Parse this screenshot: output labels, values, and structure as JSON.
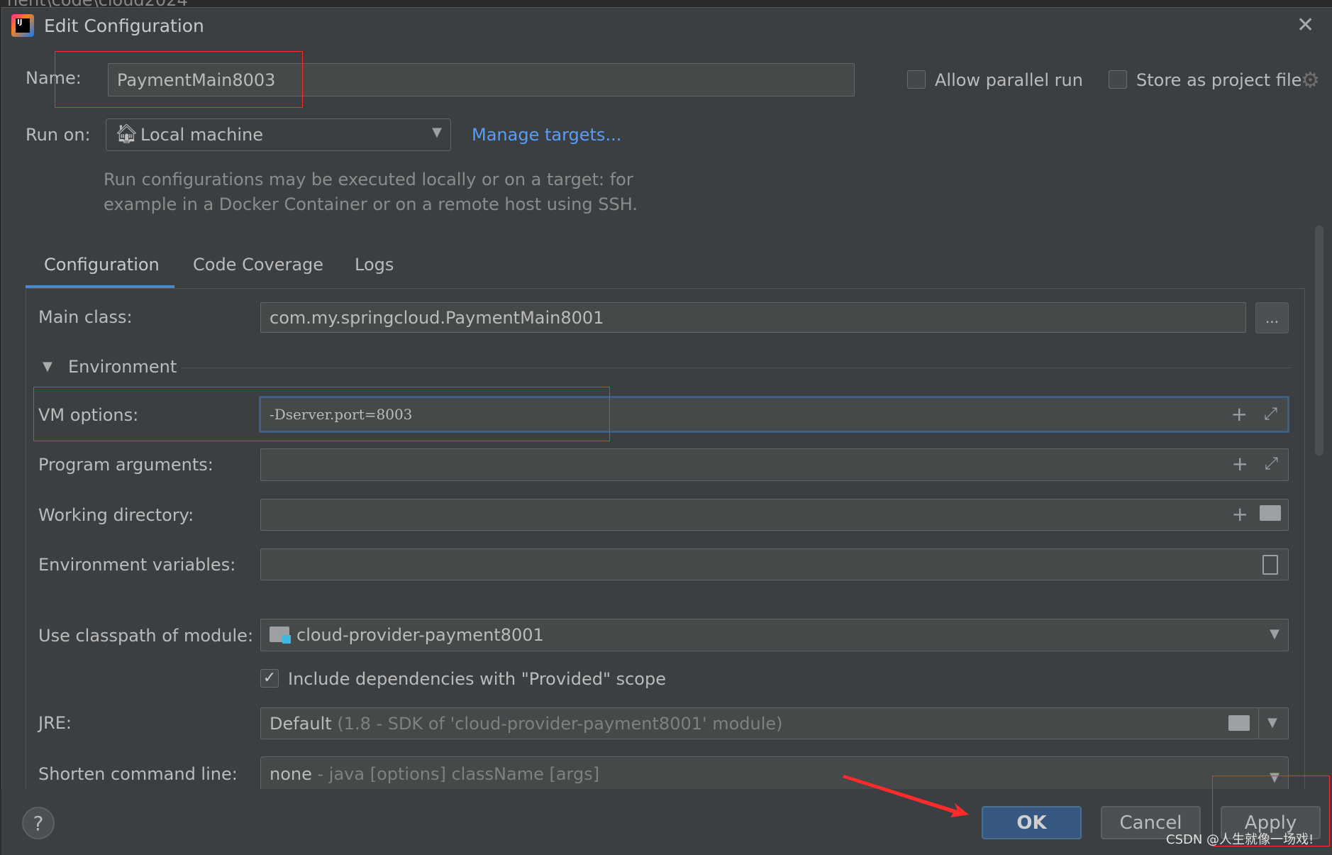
{
  "background_window": {
    "path_fragment": "nent\\code\\cloud2024"
  },
  "dialog": {
    "title": "Edit Configuration",
    "name_label": "Name:",
    "name_value": "PaymentMain8003",
    "allow_parallel_run": {
      "label": "Allow parallel run",
      "checked": false
    },
    "store_as_project_file": {
      "label": "Store as project file",
      "checked": false
    },
    "run_on_label": "Run on:",
    "run_on_value": "Local machine",
    "manage_targets_link": "Manage targets...",
    "description_lines": [
      "Run configurations may be executed locally or on a target: for",
      "example in a Docker Container or on a remote host using SSH."
    ],
    "tabs": [
      {
        "label": "Configuration",
        "active": true
      },
      {
        "label": "Code Coverage",
        "active": false
      },
      {
        "label": "Logs",
        "active": false
      }
    ],
    "main_class_label": "Main class:",
    "main_class_value": "com.my.springcloud.PaymentMain8001",
    "browse_button": "...",
    "environment_section": "Environment",
    "vm_options_label": "VM options:",
    "vm_options_value": "-Dserver.port=8003",
    "program_arguments_label": "Program arguments:",
    "program_arguments_value": "",
    "working_directory_label": "Working directory:",
    "working_directory_value": "",
    "environment_variables_label": "Environment variables:",
    "environment_variables_value": "",
    "classpath_label": "Use classpath of module:",
    "classpath_value": "cloud-provider-payment8001",
    "include_dependencies": {
      "label": "Include dependencies with \"Provided\" scope",
      "checked": true
    },
    "jre_label": "JRE:",
    "jre_value": "Default",
    "jre_hint": "(1.8 - SDK of 'cloud-provider-payment8001' module)",
    "shorten_label": "Shorten command line:",
    "shorten_value": "none",
    "shorten_hint": "- java [options] className [args]",
    "buttons": {
      "help": "?",
      "ok": "OK",
      "cancel": "Cancel",
      "apply": "Apply"
    },
    "watermark": "CSDN @人生就像一场戏!"
  },
  "colors": {
    "accent": "#589df6",
    "ok_button": "#365880",
    "annotation_red": "#ff2a2a",
    "background": "#3c3f41"
  }
}
